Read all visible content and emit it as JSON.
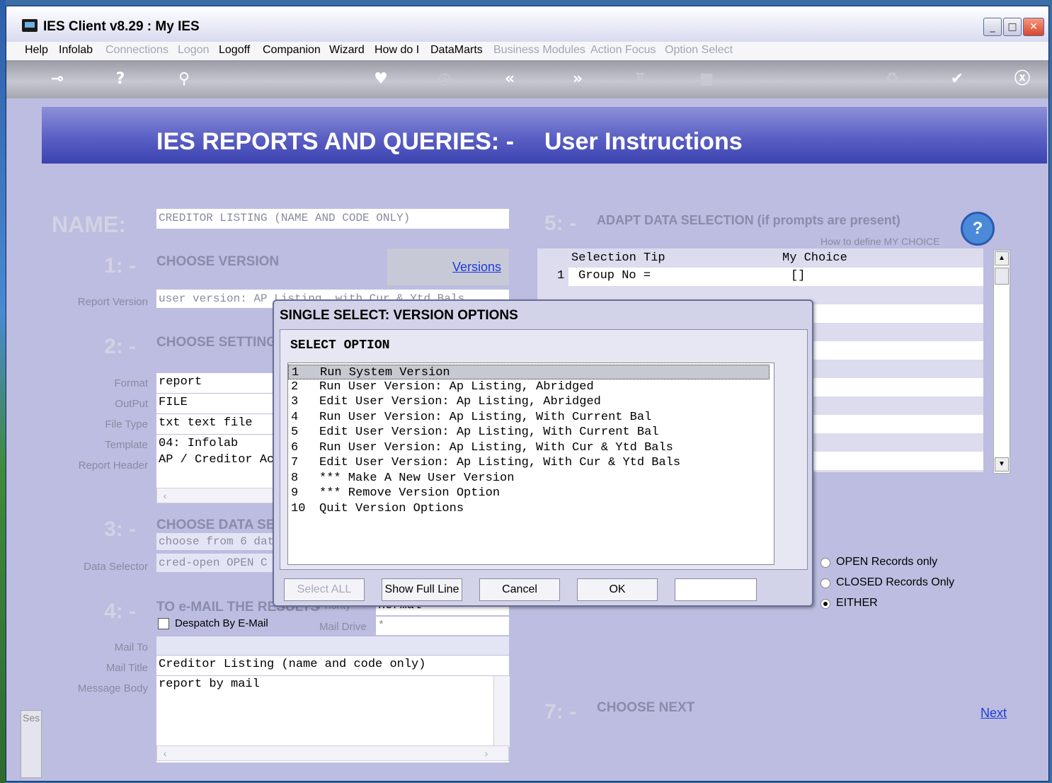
{
  "window": {
    "title": "IES Client v8.29 : My IES"
  },
  "menu": [
    {
      "label": "Help",
      "enabled": true
    },
    {
      "label": "Infolab",
      "enabled": true
    },
    {
      "label": "Connections",
      "enabled": false
    },
    {
      "label": "Logon",
      "enabled": false
    },
    {
      "label": "Logoff",
      "enabled": true
    },
    {
      "label": "Companion",
      "enabled": true
    },
    {
      "label": "Wizard",
      "enabled": true
    },
    {
      "label": "How do I",
      "enabled": true
    },
    {
      "label": "DataMarts",
      "enabled": true
    },
    {
      "label": "Business Modules",
      "enabled": false
    },
    {
      "label": "Action Focus",
      "enabled": false
    },
    {
      "label": "Option Select",
      "enabled": false
    }
  ],
  "toolbar": {
    "icons": [
      "key-icon",
      "help-icon",
      "search-icon",
      "heart-icon",
      "clock-icon",
      "rewind-icon",
      "forward-icon",
      "tree-icon",
      "stop-icon",
      "recycle-icon",
      "check-icon",
      "close-icon"
    ]
  },
  "banner": {
    "title": "IES REPORTS AND QUERIES: -",
    "subtitle": "User Instructions"
  },
  "name": {
    "label": "NAME:",
    "value": "CREDITOR LISTING (NAME AND CODE ONLY)"
  },
  "section1": {
    "num": "1: -",
    "title": "CHOOSE VERSION",
    "link": "Versions",
    "report_version_label": "Report Version",
    "report_version_value": "user version: AP Listing, with Cur & Ytd Bals"
  },
  "section2": {
    "num": "2: -",
    "title": "CHOOSE SETTINGS",
    "fields": [
      {
        "label": "Format",
        "value": "report"
      },
      {
        "label": "OutPut",
        "value": "FILE"
      },
      {
        "label": "File Type",
        "value": "txt text file"
      },
      {
        "label": "Template",
        "value": "04: Infolab"
      },
      {
        "label": "Report Header",
        "value": "AP / Creditor Ac"
      }
    ]
  },
  "section3": {
    "num": "3: -",
    "title": "CHOOSE DATA SELECTION",
    "choose_text": "choose from 6 data",
    "data_selector_label": "Data Selector",
    "data_selector_value": "cred-open OPEN C"
  },
  "section4": {
    "num": "4: -",
    "title": "TO e-MAIL THE RESULTS",
    "priority_label": "Priority",
    "priority_value": "normal",
    "despatch_label": "Despatch By E-Mail",
    "mail_drive_label": "Mail Drive",
    "mail_drive_value": "*",
    "mail_to_label": "Mail To",
    "mail_to_value": "",
    "mail_title_label": "Mail Title",
    "mail_title_value": "Creditor Listing (name and code only)",
    "message_body_label": "Message Body",
    "message_body_value": "report by mail"
  },
  "section5": {
    "num": "5: -",
    "title": "ADAPT DATA SELECTION (if prompts are present)",
    "how_to": "How to define MY CHOICE",
    "col_tip": "Selection Tip",
    "col_choice": "My Choice",
    "rows": [
      {
        "num": "1",
        "tip": "Group No =",
        "choice": "[]"
      }
    ]
  },
  "section6": {
    "options": [
      {
        "label": "OPEN Records only",
        "selected": false
      },
      {
        "label": "CLOSED Records Only",
        "selected": false
      },
      {
        "label": "EITHER",
        "selected": true
      }
    ]
  },
  "section7": {
    "num": "7: -",
    "title": "CHOOSE NEXT",
    "link": "Next"
  },
  "side": {
    "label": "Ses"
  },
  "dialog": {
    "title": "SINGLE SELECT: VERSION OPTIONS",
    "heading": "SELECT OPTION",
    "options": [
      {
        "n": "1",
        "text": "Run System Version"
      },
      {
        "n": "2",
        "text": "Run User Version: Ap Listing, Abridged"
      },
      {
        "n": "3",
        "text": "Edit User Version: Ap Listing, Abridged"
      },
      {
        "n": "4",
        "text": "Run User Version: Ap Listing, With Current Bal"
      },
      {
        "n": "5",
        "text": "Edit User Version: Ap Listing, With Current Bal"
      },
      {
        "n": "6",
        "text": "Run User Version: Ap Listing, With Cur & Ytd Bals"
      },
      {
        "n": "7",
        "text": "Edit User Version: Ap Listing, With Cur & Ytd Bals"
      },
      {
        "n": "8",
        "text": "*** Make A New User Version"
      },
      {
        "n": "9",
        "text": "*** Remove Version Option"
      },
      {
        "n": "10",
        "text": "Quit Version Options"
      }
    ],
    "selected_index": 0,
    "buttons": {
      "select_all": "Select ALL",
      "show_full": "Show Full Line",
      "cancel": "Cancel",
      "ok": "OK"
    },
    "input_value": ""
  }
}
